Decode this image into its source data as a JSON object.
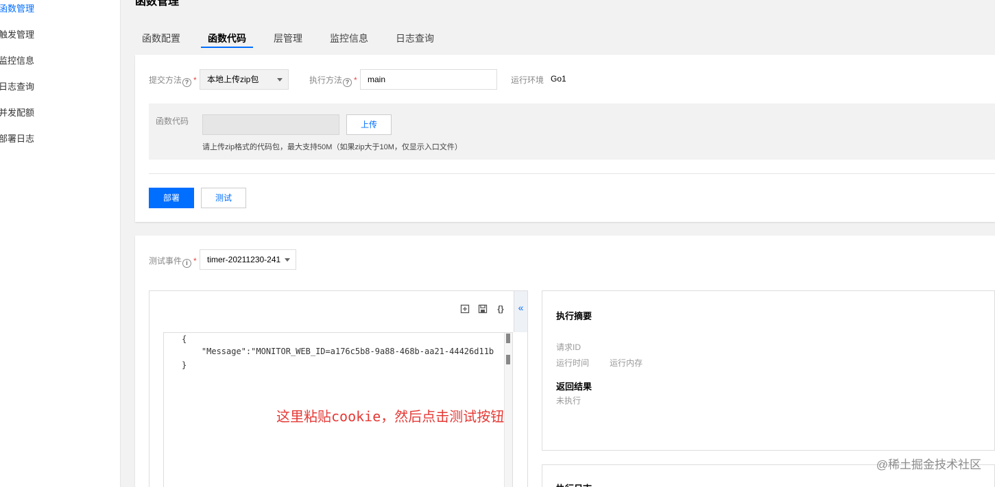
{
  "sidebar": {
    "items": [
      {
        "label": "函数管理",
        "active": true
      },
      {
        "label": "触发管理",
        "active": false
      },
      {
        "label": "监控信息",
        "active": false
      },
      {
        "label": "日志查询",
        "active": false
      },
      {
        "label": "并发配额",
        "active": false
      },
      {
        "label": "部署日志",
        "active": false
      }
    ]
  },
  "page": {
    "title": "函数管理"
  },
  "tabs": [
    {
      "label": "函数配置"
    },
    {
      "label": "函数代码",
      "active": true
    },
    {
      "label": "层管理"
    },
    {
      "label": "监控信息"
    },
    {
      "label": "日志查询"
    }
  ],
  "code_config": {
    "submit_method": {
      "label": "提交方法",
      "required_mark": "*",
      "value": "本地上传zip包"
    },
    "exec_method": {
      "label": "执行方法",
      "required_mark": "*",
      "value": "main"
    },
    "runtime": {
      "label": "运行环境",
      "value": "Go1"
    },
    "function_code": {
      "label": "函数代码",
      "upload_label": "上传",
      "hint": "请上传zip格式的代码包，最大支持50M（如果zip大于10M，仅显示入口文件）"
    },
    "help_icon": "question-circle-icon"
  },
  "actions": {
    "deploy_label": "部署",
    "test_label": "测试"
  },
  "test": {
    "event": {
      "label": "测试事件",
      "required_mark": "*",
      "value": "timer-20211230-241",
      "info_icon": "info-circle-icon"
    },
    "editor": {
      "lines": [
        "{",
        "    \"Message\":\"MONITOR_WEB_ID=a176c5b8-9a88-468b-aa21-44426d11b",
        "}"
      ],
      "collapse_glyph": "«"
    },
    "annotation": "这里粘贴cookie，然后点击测试按钮"
  },
  "result": {
    "summary_title": "执行摘要",
    "request_id_label": "请求ID",
    "run_time_label": "运行时间",
    "run_memory_label": "运行内存",
    "return_title": "返回结果",
    "return_value": "未执行",
    "log_title": "执行日志"
  },
  "watermark": "@稀土掘金技术社区",
  "colors": {
    "primary": "#006eff",
    "required": "#e54545",
    "annotation": "#e53935"
  }
}
